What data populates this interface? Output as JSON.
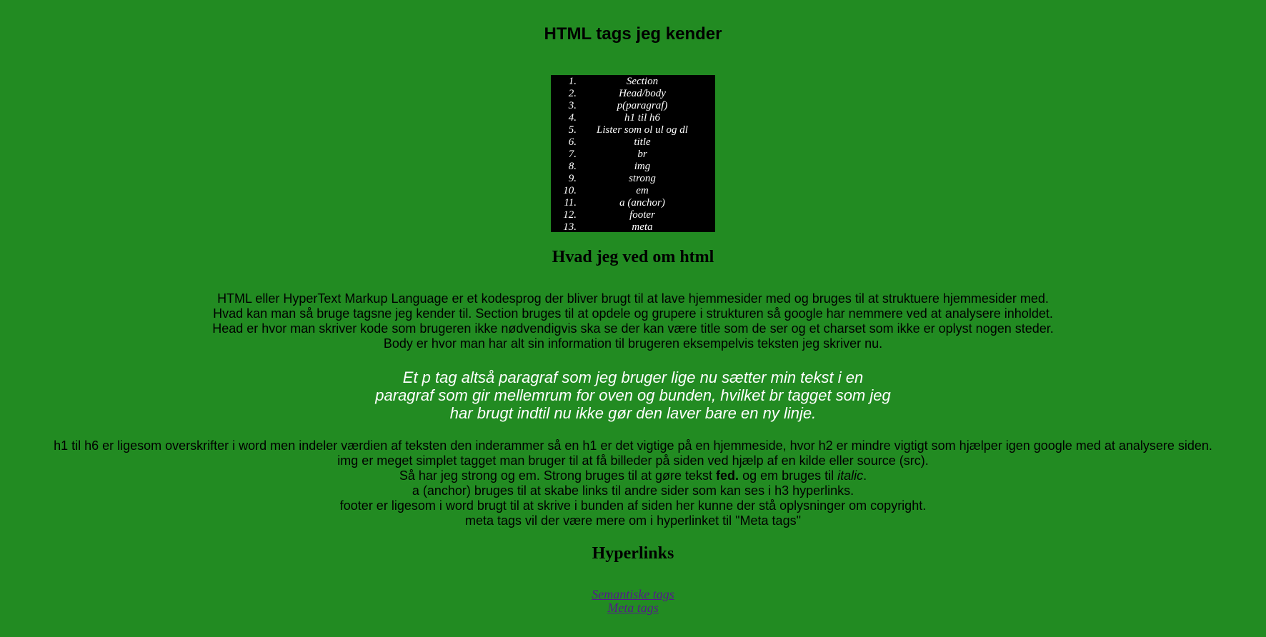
{
  "main_title": "HTML tags jeg kender",
  "tag_list": [
    {
      "num": "1.",
      "label": "Section"
    },
    {
      "num": "2.",
      "label": "Head/body"
    },
    {
      "num": "3.",
      "label": "p(paragraf)"
    },
    {
      "num": "4.",
      "label": "h1 til h6"
    },
    {
      "num": "5.",
      "label": "Lister som ol ul og dl"
    },
    {
      "num": "6.",
      "label": "title"
    },
    {
      "num": "7.",
      "label": "br"
    },
    {
      "num": "8.",
      "label": "img"
    },
    {
      "num": "9.",
      "label": "strong"
    },
    {
      "num": "10.",
      "label": "em"
    },
    {
      "num": "11.",
      "label": "a (anchor)"
    },
    {
      "num": "12.",
      "label": "footer"
    },
    {
      "num": "13.",
      "label": "meta"
    }
  ],
  "about_title": "Hvad jeg ved om html",
  "intro_lines": [
    "HTML eller HyperText Markup Language er et kodesprog der bliver brugt til at lave hjemmesider med og bruges til at struktuere hjemmesider med.",
    "Hvad kan man så bruge tagsne jeg kender til. Section bruges til at opdele og grupere i strukturen så google har nemmere ved at analysere inholdet.",
    "Head er hvor man skriver kode som brugeren ikke nødvendigvis ska se der kan være title som de ser og et charset som ikke er oplyst nogen steder.",
    "Body er hvor man har alt sin information til brugeren eksempelvis teksten jeg skriver nu."
  ],
  "p_tag_lines": [
    "Et p tag altså paragraf som jeg bruger lige nu sætter min tekst i en",
    "paragraf som gir mellemrum for oven og bunden, hvilket br tagget som jeg",
    "har brugt indtil nu ikke gør den laver bare en ny linje."
  ],
  "details": {
    "line1": "h1 til h6 er ligesom overskrifter i word men indeler værdien af teksten den inderammer så en h1 er det vigtige på en hjemmeside, hvor h2 er mindre vigtigt som hjælper igen google med at analysere siden.",
    "line2": "img er meget simplet tagget man bruger til at få billeder på siden ved hjælp af en kilde eller source (src).",
    "line3_a": "Så har jeg strong og em. Strong bruges til at gøre tekst ",
    "line3_strong": "fed.",
    "line3_b": " og em bruges til ",
    "line3_em": "italic",
    "line3_c": ".",
    "line4": "a (anchor) bruges til at skabe links til andre sider som kan ses i h3 hyperlinks.",
    "line5": "footer er ligesom i word brugt til at skrive i bunden af siden her kunne der stå oplysninger om copyright.",
    "line6": "meta tags vil der være mere om i hyperlinket til \"Meta tags\""
  },
  "hyperlinks_title": "Hyperlinks",
  "links": [
    {
      "label": "Semantiske tags"
    },
    {
      "label": "Meta tags"
    }
  ],
  "colors": {
    "background": "#228b22",
    "list_box": "#000000",
    "link": "#551a8b",
    "highlight_text": "#ffffff"
  }
}
